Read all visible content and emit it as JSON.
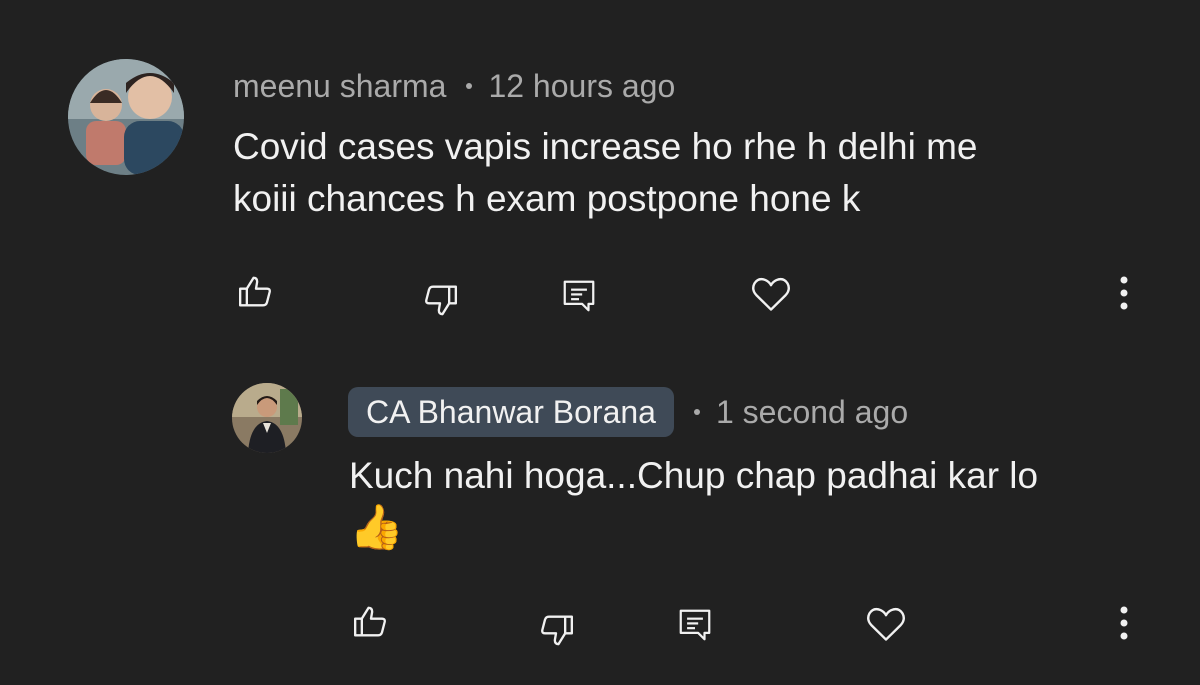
{
  "comment": {
    "author": "meenu sharma",
    "time": "12 hours ago",
    "line1": "Covid cases vapis increase ho rhe h delhi me",
    "line2": "koiii chances h exam postpone hone k",
    "avatar_icon": "user-avatar-photo"
  },
  "reply": {
    "author": "CA Bhanwar Borana",
    "time": "1 second ago",
    "line1": "Kuch nahi hoga...Chup chap padhai kar lo",
    "emoji": "👍",
    "avatar_icon": "creator-avatar-photo"
  },
  "actions": {
    "like_icon": "thumbs-up-icon",
    "dislike_icon": "thumbs-down-icon",
    "reply_icon": "reply-comment-icon",
    "heart_icon": "heart-icon",
    "more_icon": "more-vertical-icon"
  },
  "colors": {
    "background": "#212121",
    "text": "#f1f1f1",
    "meta": "#aaaaaa",
    "author_chip": "#3f4a57"
  }
}
